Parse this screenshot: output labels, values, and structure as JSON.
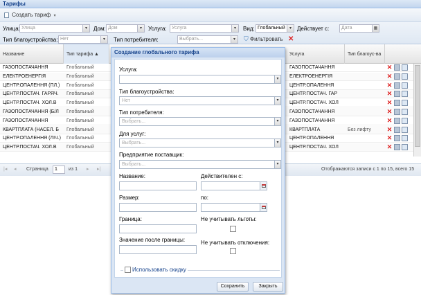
{
  "panel": {
    "title": "Тарифы"
  },
  "toolbar": {
    "create_label": "Создать тариф",
    "create_arrow": "▾"
  },
  "filters": {
    "street": {
      "label": "Улица:",
      "placeholder": "Улица"
    },
    "house": {
      "label": "Дом:",
      "placeholder": "Дом"
    },
    "service": {
      "label": "Услуга:",
      "placeholder": "Услуга"
    },
    "kind": {
      "label": "Вид:",
      "value": "Глобальный"
    },
    "valid_from": {
      "label": "Действует с:",
      "placeholder": "Дата"
    },
    "improvement_type": {
      "label": "Тип благоустройства:",
      "value": "Нет"
    },
    "consumer_type": {
      "label": "Тип потребителя:",
      "placeholder": "Выбрать..."
    },
    "filter_button": "Фильтровать"
  },
  "grid": {
    "columns_left": [
      "Название",
      "Тип тарифа ▲"
    ],
    "columns_right": [
      "Услуга",
      "Тип благоус-ва"
    ],
    "rows": [
      {
        "name": "ГАЗОПОСТАЧАННЯ",
        "type": "Глобальный",
        "service": "ГАЗОПОСТАЧАННЯ",
        "improvement": ""
      },
      {
        "name": "ЕЛЕКТРОЕНЕРГІЯ",
        "type": "Глобальный",
        "service": "ЕЛЕКТРОЕНЕРГІЯ",
        "improvement": ""
      },
      {
        "name": "ЦЕНТР.ОПАЛЕННЯ (ПЛ.)",
        "type": "Глобальный",
        "service": "ЦЕНТР.ОПАЛЕННЯ",
        "improvement": ""
      },
      {
        "name": "ЦЕНТР.ПОСТАЧ. ГАРЯЧ.",
        "type": "Глобальный",
        "service": "ЦЕНТР.ПОСТАЧ. ГАР",
        "improvement": ""
      },
      {
        "name": "ЦЕНТР.ПОСТАЧ. ХОЛ.В",
        "type": "Глобальный",
        "service": "ЦЕНТР.ПОСТАЧ. ХОЛ",
        "improvement": ""
      },
      {
        "name": "ГАЗОПОСТАЧАННЯ (Б/Л",
        "type": "Глобальный",
        "service": "ГАЗОПОСТАЧАННЯ",
        "improvement": ""
      },
      {
        "name": "ГАЗОПОСТАЧАННЯ",
        "type": "Глобальный",
        "service": "ГАЗОПОСТАЧАННЯ",
        "improvement": ""
      },
      {
        "name": "КВАРТПЛАТА (НАСЕЛ. Б",
        "type": "Глобальный",
        "service": "КВАРТПЛАТА",
        "improvement": "Без лифту"
      },
      {
        "name": "ЦЕНТР.ОПАЛЕННЯ (ЛІЧ.)",
        "type": "Глобальный",
        "service": "ЦЕНТР.ОПАЛЕННЯ",
        "improvement": ""
      },
      {
        "name": "ЦЕНТР.ПОСТАЧ. ХОЛ.В",
        "type": "Глобальный",
        "service": "ЦЕНТР.ПОСТАЧ. ХОЛ",
        "improvement": ""
      }
    ]
  },
  "pager": {
    "page_label": "Страница",
    "page_value": "1",
    "of_label": "из 1",
    "summary": "Отображаются записи с 1 по 15, всего 15"
  },
  "dialog": {
    "title": "Создание глобального тарифа",
    "service_label": "Услуга:",
    "improvement_label": "Тип благоустройства:",
    "improvement_value": "Нет",
    "consumer_label": "Тип потребителя:",
    "consumer_placeholder": "Выбрать...",
    "for_services_label": "Для услуг:",
    "for_services_placeholder": "Выбрать...",
    "supplier_label": "Предприятие поставщик:",
    "supplier_placeholder": "Выбрать...",
    "name_label": "Название:",
    "valid_from_label": "Действителен с:",
    "size_label": "Размер:",
    "valid_to_label": "по:",
    "limit_label": "Граница:",
    "ignore_benefits_label": "Не учитывать льготы:",
    "after_limit_label": "Значение после границы:",
    "ignore_shutdowns_label": "Не учитывать отключения:",
    "use_discount_label": "Использовать скидку",
    "save_label": "Сохранить",
    "close_label": "Закрыть"
  },
  "colors": {
    "header_text": "#15428b",
    "delete_icon": "#dd2222"
  }
}
